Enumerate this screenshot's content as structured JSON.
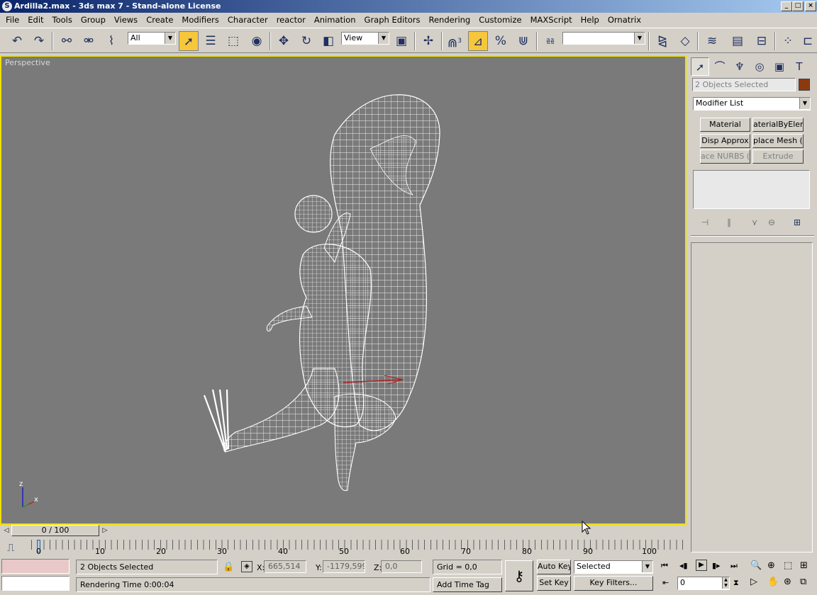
{
  "window": {
    "title": "Ardilla2.max - 3ds max 7  - Stand-alone License",
    "icon": "S",
    "controls": [
      "_",
      "□",
      "×"
    ]
  },
  "menu": [
    "File",
    "Edit",
    "Tools",
    "Group",
    "Views",
    "Create",
    "Modifiers",
    "Character",
    "reactor",
    "Animation",
    "Graph Editors",
    "Rendering",
    "Customize",
    "MAXScript",
    "Help",
    "Ornatrix"
  ],
  "toolbar": {
    "selection_filter": "All",
    "reference_coord": "View",
    "named_selection": "",
    "snap_angle_label": "3",
    "icons": [
      "undo-icon",
      "redo-icon",
      "select-link-icon",
      "unlink-icon",
      "bind-spacewarp-icon",
      "select-object-icon",
      "select-by-name-icon",
      "rect-region-icon",
      "window-crossing-icon",
      "move-icon",
      "rotate-icon",
      "scale-icon",
      "pivot-icon",
      "manipulate-icon",
      "snap-icon",
      "angle-snap-icon",
      "percent-snap-icon",
      "spinner-snap-icon",
      "edit-named-sel-icon",
      "mirror-icon",
      "align-icon",
      "layer-icon",
      "curve-editor-icon",
      "schematic-icon",
      "material-editor-icon",
      "render-icon"
    ]
  },
  "viewport": {
    "label": "Perspective",
    "axis_x": "x",
    "axis_z": "z",
    "border_color": "#f0e000",
    "background": "#7a7a7a"
  },
  "command_panel": {
    "selection_name": "2 Objects Selected",
    "object_color": "#8b3a10",
    "modifier_list": "Modifier List",
    "buttons": [
      {
        "label": "Material",
        "enabled": true
      },
      {
        "label": "aterialByEleme",
        "enabled": true
      },
      {
        "label": "Disp Approx",
        "enabled": true
      },
      {
        "label": "place Mesh (W",
        "enabled": true
      },
      {
        "label": "ace NURBS (W",
        "enabled": false
      },
      {
        "label": "Extrude",
        "enabled": false
      }
    ]
  },
  "timeline": {
    "frame_display": "0 / 100",
    "ticks": [
      "0",
      "10",
      "20",
      "30",
      "40",
      "50",
      "60",
      "70",
      "80",
      "90",
      "100"
    ]
  },
  "status": {
    "selection": "2 Objects Selected",
    "render_time": "Rendering Time  0:00:04",
    "x_label": "X:",
    "x_value": "665,514",
    "y_label": "Y:",
    "y_value": "-1179,599",
    "z_label": "Z:",
    "z_value": "0,0",
    "grid": "Grid = 0,0",
    "add_time_tag": "Add Time Tag",
    "auto_key": "Auto Key",
    "set_key": "Set Key",
    "key_mode": "Selected",
    "key_filters": "Key Filters...",
    "current_frame": "0"
  }
}
